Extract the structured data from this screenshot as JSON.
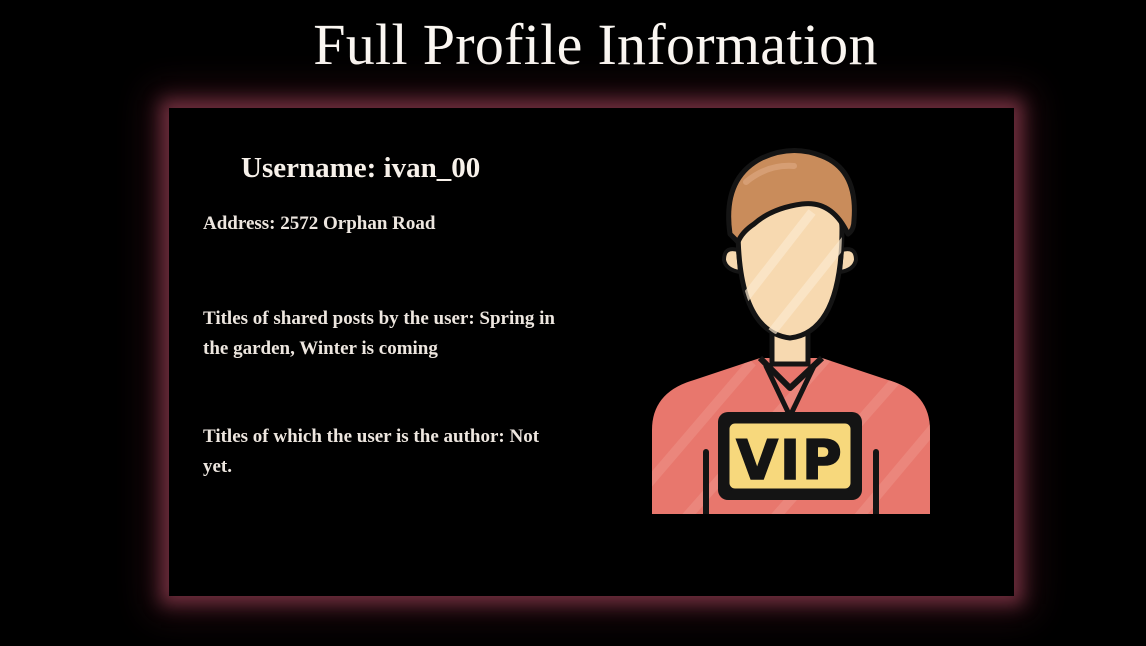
{
  "page": {
    "title": "Full Profile Information"
  },
  "profile": {
    "username": "Username: ivan_00",
    "address": "Address: 2572 Orphan Road",
    "shared_posts": "Titles of shared posts by the user: Spring in the garden, Winter is coming",
    "authored_titles": "Titles of which the user is the author: Not yet.",
    "avatar_icon": "vip-user-icon",
    "badge_text": "VIP"
  },
  "colors": {
    "background": "#000000",
    "card_glow": "#7a3444",
    "text": "#f3ece6",
    "shirt": "#e8776d",
    "skin": "#f7d9b0",
    "hair": "#c98c5b",
    "badge": "#f7d87c",
    "outline": "#141414"
  }
}
